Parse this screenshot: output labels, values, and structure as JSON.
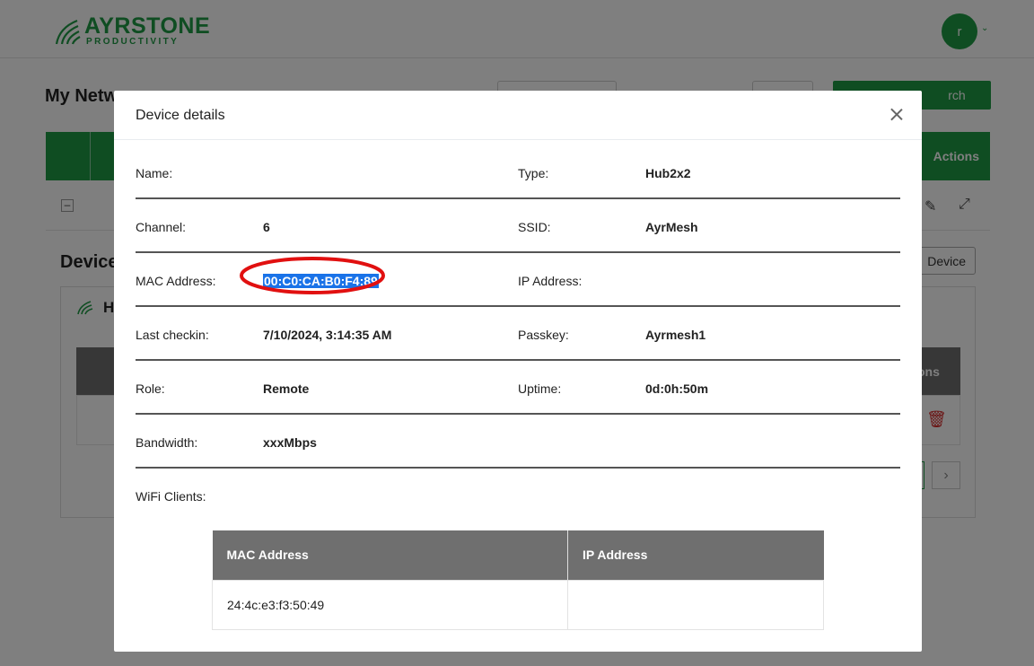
{
  "app": {
    "logo_main": "AYRSTONE",
    "logo_sub": "PRODUCTIVITY",
    "user_initial": "r",
    "accent_color": "#1e9a45"
  },
  "background": {
    "page_title": "My Netw",
    "search_button": "rch",
    "table_actions_header": "Actions",
    "devices_title": "Device",
    "add_device_button": "Device",
    "card_heading": "H",
    "inner_actions_header": "ons"
  },
  "modal": {
    "title": "Device details",
    "rows": [
      {
        "left_label": "Name:",
        "left_value": "",
        "right_label": "Type:",
        "right_value": "Hub2x2"
      },
      {
        "left_label": "Channel:",
        "left_value": "6",
        "right_label": "SSID:",
        "right_value": "AyrMesh"
      },
      {
        "left_label": "MAC Address:",
        "left_value": "00:C0:CA:B0:F4:89",
        "right_label": "IP Address:",
        "right_value": ""
      },
      {
        "left_label": "Last checkin:",
        "left_value": "7/10/2024, 3:14:35 AM",
        "right_label": "Passkey:",
        "right_value": "Ayrmesh1"
      },
      {
        "left_label": "Role:",
        "left_value": "Remote",
        "right_label": "Uptime:",
        "right_value": "0d:0h:50m"
      },
      {
        "left_label": "Bandwidth:",
        "left_value": "xxxMbps",
        "right_label": "",
        "right_value": ""
      }
    ],
    "wifi_clients_label": "WiFi Clients:",
    "clients_table": {
      "headers": [
        "MAC Address",
        "IP Address"
      ],
      "rows": [
        [
          "24:4c:e3:f3:50:49",
          ""
        ]
      ]
    }
  }
}
